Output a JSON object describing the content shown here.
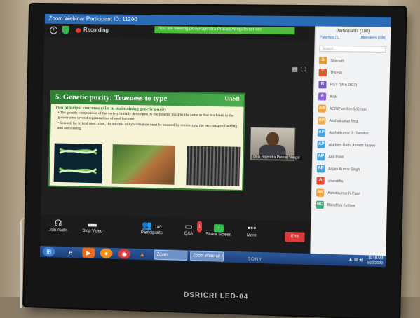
{
  "window": {
    "title": "Zoom Webinar Participant ID: 11200"
  },
  "meeting": {
    "recording_label": "Recording",
    "banner_text": "You are viewing Dr.G.Rajendra Prasad Vengal's screen"
  },
  "slide": {
    "heading": "5. Genetic purity: Trueness to type",
    "logo": "UASB",
    "subheading": "Two principal concerns exist in maintaining genetic purity",
    "bullets": [
      "• The genetic composition of the variety initially developed by the breeder must be the same as that marketed to the grower after several regenerations of seed increase",
      "• Second, for hybrid seed crops, the success of hybridization must be ensured by minimizing the percentage of selfing and outcrossing"
    ]
  },
  "speaker": {
    "name": "Dr.G.Rajendra Prasad Vengal"
  },
  "participants_panel": {
    "title": "Participants (180)",
    "tabs": [
      "Panelists (1)",
      "Attendees (180)"
    ],
    "search_placeholder": "Search",
    "items": [
      {
        "initials": "S",
        "name": "Shivnath",
        "color": "#e69b2e"
      },
      {
        "initials": "T",
        "name": "Thiresh",
        "color": "#e0592a"
      },
      {
        "initials": "R",
        "name": "RGT (SRA 2019)",
        "color": "#7b5cc4"
      },
      {
        "initials": "A",
        "name": "Aruk",
        "color": "#8e63d6"
      },
      {
        "initials": "AN",
        "name": "ACRIP on Seed (Crops)",
        "color": "#f2a23a"
      },
      {
        "initials": "AK",
        "name": "Akshatkumar Negi",
        "color": "#f0b04a"
      },
      {
        "initials": "AP",
        "name": "Akshatkumar Jr. Sanskar",
        "color": "#4aa3d8"
      },
      {
        "initials": "AP",
        "name": "Alathien Gath, Anneth Jadeer",
        "color": "#4aa3d8"
      },
      {
        "initials": "AP",
        "name": "Anil Patel",
        "color": "#4aa3d8"
      },
      {
        "initials": "AP",
        "name": "Anjani Kumar Singh",
        "color": "#4aa3d8"
      },
      {
        "initials": "A",
        "name": "anuradha",
        "color": "#e04a3a"
      },
      {
        "initials": "AK",
        "name": "Ashokkumar N Patel",
        "color": "#f2a23a"
      },
      {
        "initials": "BC",
        "name": "Baladitya Kuthwa",
        "color": "#3ab07a"
      }
    ]
  },
  "toolbar": {
    "join_audio": "Join Audio",
    "stop_video": "Stop Video",
    "participants": "Participants",
    "participants_count": "180",
    "qa": "Q&A",
    "qa_badge": "1",
    "share_screen": "Share Screen",
    "more": "More",
    "end": "End"
  },
  "taskbar": {
    "zoom_label": "Zoom",
    "zoom_webinar_label": "Zoom Webinar Pa...",
    "time": "11:48 AM",
    "date": "6/10/2020"
  },
  "tv": {
    "brand": "SONY",
    "model_text": "DSRICRI  LED-04"
  }
}
